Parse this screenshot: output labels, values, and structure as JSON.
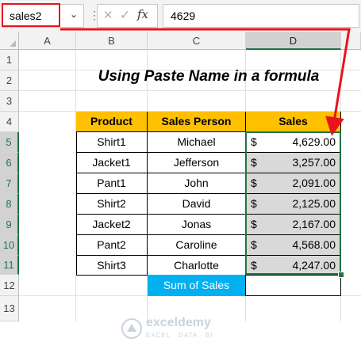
{
  "formula_bar": {
    "name_box": "sales2",
    "dropdown_glyph": "⌄",
    "separator": "⋮",
    "cancel_glyph": "✕",
    "enter_glyph": "✓",
    "fx_label": "fx",
    "formula_value": "4629"
  },
  "columns": [
    "A",
    "B",
    "C",
    "D"
  ],
  "rows": [
    "1",
    "2",
    "3",
    "4",
    "5",
    "6",
    "7",
    "8",
    "9",
    "10",
    "11",
    "12",
    "13"
  ],
  "sheet": {
    "title": "Using Paste Name in a formula",
    "headers": {
      "product": "Product",
      "sales_person": "Sales Person",
      "sales": "Sales"
    },
    "records": [
      {
        "product": "Shirt1",
        "person": "Michael",
        "currency": "$",
        "amount": "4,629.00"
      },
      {
        "product": "Jacket1",
        "person": "Jefferson",
        "currency": "$",
        "amount": "3,257.00"
      },
      {
        "product": "Pant1",
        "person": "John",
        "currency": "$",
        "amount": "2,091.00"
      },
      {
        "product": "Shirt2",
        "person": "David",
        "currency": "$",
        "amount": "2,125.00"
      },
      {
        "product": "Jacket2",
        "person": "Jonas",
        "currency": "$",
        "amount": "2,167.00"
      },
      {
        "product": "Pant2",
        "person": "Caroline",
        "currency": "$",
        "amount": "4,568.00"
      },
      {
        "product": "Shirt3",
        "person": "Charlotte",
        "currency": "$",
        "amount": "4,247.00"
      }
    ],
    "sum_label": "Sum of Sales"
  },
  "watermark": {
    "name": "exceldemy",
    "tagline": "EXCEL · DATA · BI"
  },
  "colors": {
    "accent_green": "#217346",
    "header_fill": "#ffc000",
    "sales_fill": "#d9d9d9",
    "sum_fill": "#00b0f0",
    "annotation_red": "#e8141b"
  }
}
